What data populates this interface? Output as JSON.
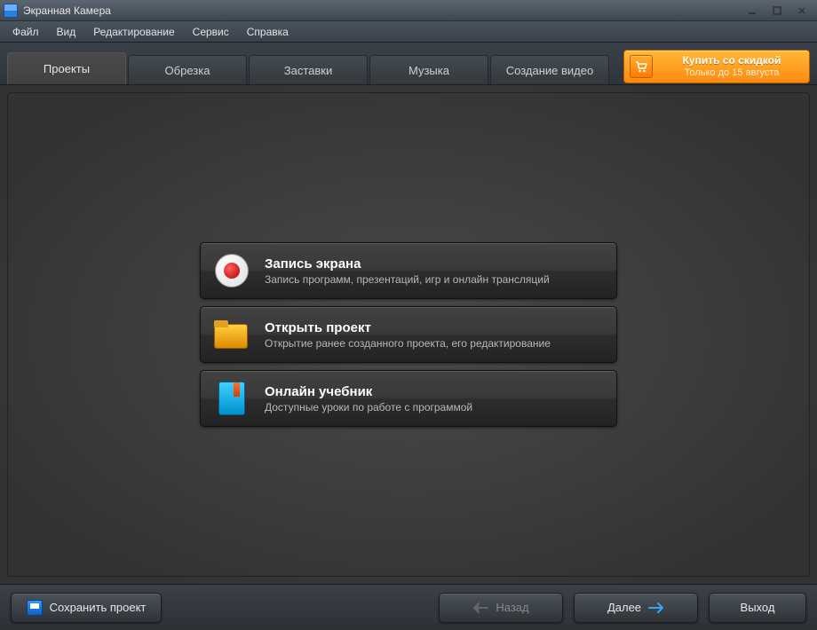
{
  "titlebar": {
    "title": "Экранная Камера"
  },
  "menu": {
    "file": "Файл",
    "view": "Вид",
    "edit": "Редактирование",
    "service": "Сервис",
    "help": "Справка"
  },
  "tabs": {
    "projects": "Проекты",
    "trim": "Обрезка",
    "intros": "Заставки",
    "music": "Музыка",
    "create": "Создание видео"
  },
  "buy": {
    "main": "Купить со скидкой",
    "sub": "Только до 15 августа"
  },
  "actions": {
    "record": {
      "title": "Запись экрана",
      "desc": "Запись программ, презентаций, игр и онлайн трансляций"
    },
    "open": {
      "title": "Открыть проект",
      "desc": "Открытие ранее созданного проекта, его редактирование"
    },
    "tutorial": {
      "title": "Онлайн учебник",
      "desc": "Доступные уроки по работе с программой"
    }
  },
  "bottom": {
    "save": "Сохранить проект",
    "back": "Назад",
    "next": "Далее",
    "exit": "Выход"
  }
}
